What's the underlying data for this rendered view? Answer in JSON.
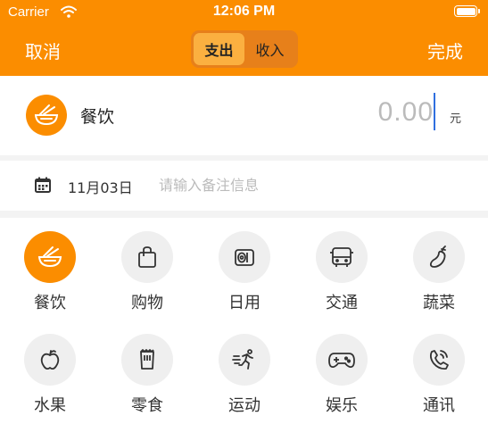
{
  "status_bar": {
    "carrier": "Carrier",
    "time": "12:06 PM"
  },
  "nav": {
    "cancel": "取消",
    "done": "完成",
    "segment": [
      "支出",
      "收入"
    ],
    "active_segment": 0
  },
  "amount": {
    "category_icon": "noodle-bowl-icon",
    "category_label": "餐饮",
    "value": "0.00",
    "unit": "元"
  },
  "note": {
    "date": "11月03日",
    "placeholder": "请输入备注信息",
    "value": ""
  },
  "categories": [
    {
      "label": "餐饮",
      "icon": "noodle-bowl-icon",
      "selected": true
    },
    {
      "label": "购物",
      "icon": "shopping-bag-icon",
      "selected": false
    },
    {
      "label": "日用",
      "icon": "toilet-paper-icon",
      "selected": false
    },
    {
      "label": "交通",
      "icon": "bus-icon",
      "selected": false
    },
    {
      "label": "蔬菜",
      "icon": "eggplant-icon",
      "selected": false
    },
    {
      "label": "水果",
      "icon": "apple-icon",
      "selected": false
    },
    {
      "label": "零食",
      "icon": "snack-icon",
      "selected": false
    },
    {
      "label": "运动",
      "icon": "running-icon",
      "selected": false
    },
    {
      "label": "娱乐",
      "icon": "gamepad-icon",
      "selected": false
    },
    {
      "label": "通讯",
      "icon": "phone-icon",
      "selected": false
    }
  ],
  "colors": {
    "accent": "#fb8d00",
    "segment_bg": "#e7801a",
    "segment_active": "#fbb040",
    "caret": "#2f6fdf",
    "icon_bg": "#efefef"
  }
}
